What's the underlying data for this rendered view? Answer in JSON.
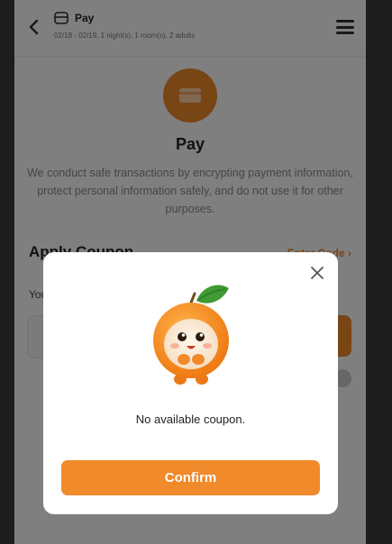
{
  "header": {
    "title": "Pay",
    "subtitle": "02/18 - 02/19, 1 night(s), 1 room(s), 2 adults"
  },
  "pay_section": {
    "title": "Pay",
    "description": "We conduct safe transactions by encrypting payment information, protect personal information safely, and do not use it for other purposes."
  },
  "coupon_section": {
    "title": "Apply Coupon",
    "enter_code_label": "Enter Code",
    "you_label": "You"
  },
  "dialog": {
    "message": "No available coupon.",
    "confirm_label": "Confirm"
  },
  "colors": {
    "accent": "#f08a2b",
    "overlay": "rgba(0,0,0,0.5)"
  },
  "icons": [
    "back-arrow-icon",
    "card-icon",
    "hamburger-menu-icon",
    "wallet-icon",
    "close-icon",
    "chevron-right-icon",
    "orange-mascot-icon"
  ]
}
